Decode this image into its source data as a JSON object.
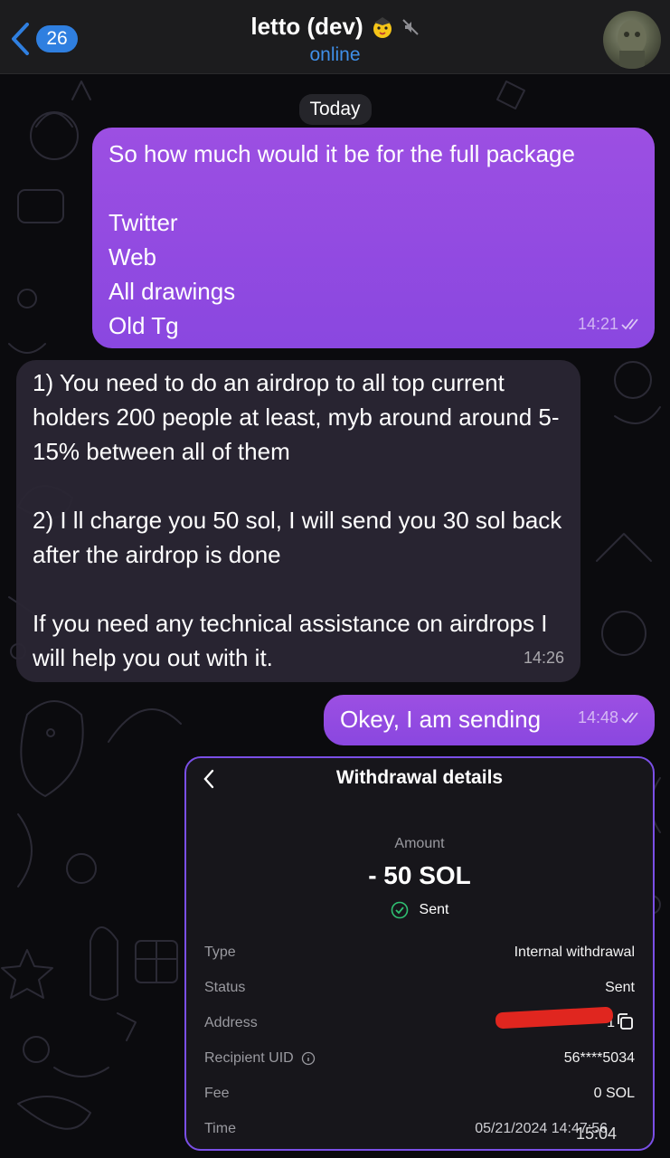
{
  "header": {
    "back_count": "26",
    "title": "letto (dev)",
    "status": "online"
  },
  "date_separator": "Today",
  "messages": [
    {
      "direction": "outgoing",
      "text": "So how much would it be for the full package\n\nTwitter\nWeb\nAll drawings\nOld Tg",
      "time": "14:21",
      "read": true
    },
    {
      "direction": "incoming",
      "text": "1) You need to do an airdrop to all top current holders 200 people at least, myb around around 5-15% between all of them\n\n2) I ll charge you 50 sol, I will send you 30 sol back after the airdrop is done\n\nIf you need any technical assistance on airdrops I will help you out with it.",
      "time": "14:26"
    },
    {
      "direction": "outgoing",
      "text": "Okey, I am sending",
      "time": "14:48",
      "read": true
    }
  ],
  "withdrawal": {
    "title": "Withdrawal details",
    "amount_label": "Amount",
    "amount": "- 50 SOL",
    "status_text": "Sent",
    "rows": [
      {
        "key": "Type",
        "value": "Internal withdrawal"
      },
      {
        "key": "Status",
        "value": "Sent"
      },
      {
        "key": "Address",
        "value": "1"
      },
      {
        "key": "Recipient UID",
        "value": "56****5034"
      },
      {
        "key": "Fee",
        "value": "0 SOL"
      },
      {
        "key": "Time",
        "value": "05/21/2024 14:47:56"
      }
    ],
    "message_time": "15:04",
    "colors": {
      "border": "#7a4fe6",
      "check": "#2fbf71",
      "redaction": "#e0261f"
    }
  },
  "colors": {
    "accent": "#2f7fe0",
    "outgoing_bubble": "#9c4fe2",
    "incoming_bubble": "#2a2634"
  },
  "icons": [
    "back-chevron-icon",
    "party-emoji-icon",
    "muted-icon",
    "read-checks-icon",
    "check-circle-icon",
    "info-icon",
    "copy-icon"
  ]
}
